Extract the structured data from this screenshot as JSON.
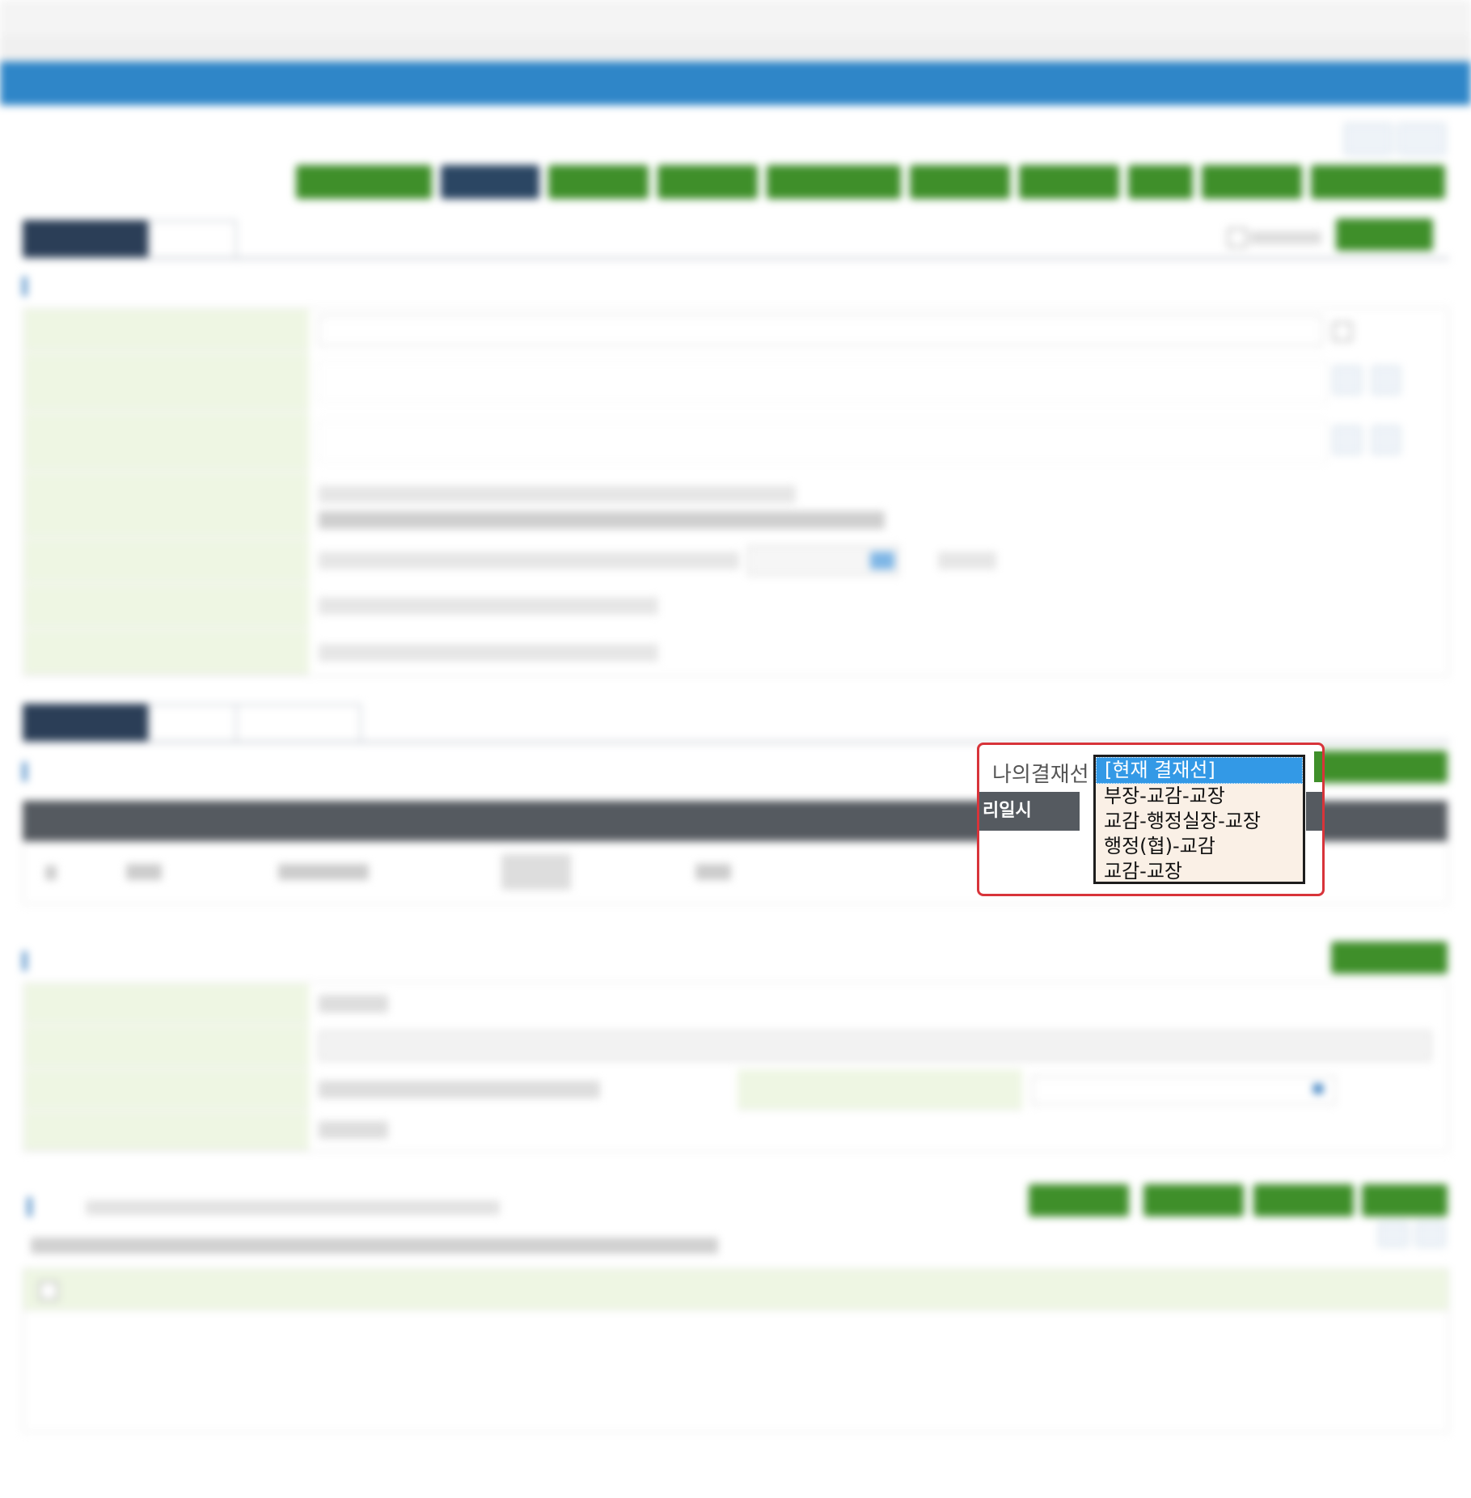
{
  "popup": {
    "label": "나의결재선",
    "options": [
      "[현재 결재선]",
      "부장-교감-교장",
      "교감-행정실장-교장",
      "행정(협)-교감",
      "교감-교장"
    ],
    "selected_index": 0,
    "column_fragment": "리일시"
  },
  "colors": {
    "title_bar": "#2f86c8",
    "button_green": "#3f8f2a",
    "tab_active": "#2b3e57",
    "popup_border": "#d8343a",
    "selected_option": "#3399e6"
  }
}
